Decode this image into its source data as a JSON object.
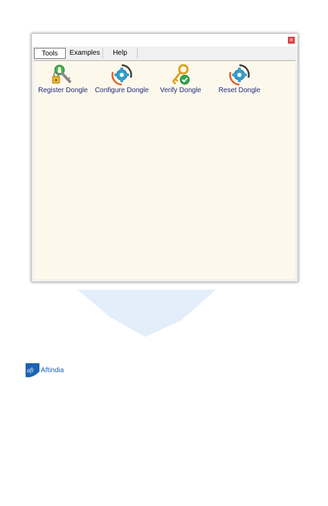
{
  "window": {
    "close_symbol": "×"
  },
  "tabs": [
    {
      "label": "Tools",
      "active": true
    },
    {
      "label": "Examples",
      "active": false
    },
    {
      "label": "Help",
      "active": false
    }
  ],
  "tools": [
    {
      "label": "Register Dongle",
      "icon": "register-key-lock-icon"
    },
    {
      "label": "Configure Dongle",
      "icon": "gear-refresh-icon"
    },
    {
      "label": "Verify Dongle",
      "icon": "key-check-icon"
    },
    {
      "label": "Reset Dongle",
      "icon": "gear-refresh-icon"
    }
  ],
  "brand": {
    "name": "Aftindia",
    "mark": "aft"
  },
  "colors": {
    "accent_blue": "#1a63b5",
    "content_bg": "#fdf8ec",
    "label_blue": "#1c2b7a"
  }
}
